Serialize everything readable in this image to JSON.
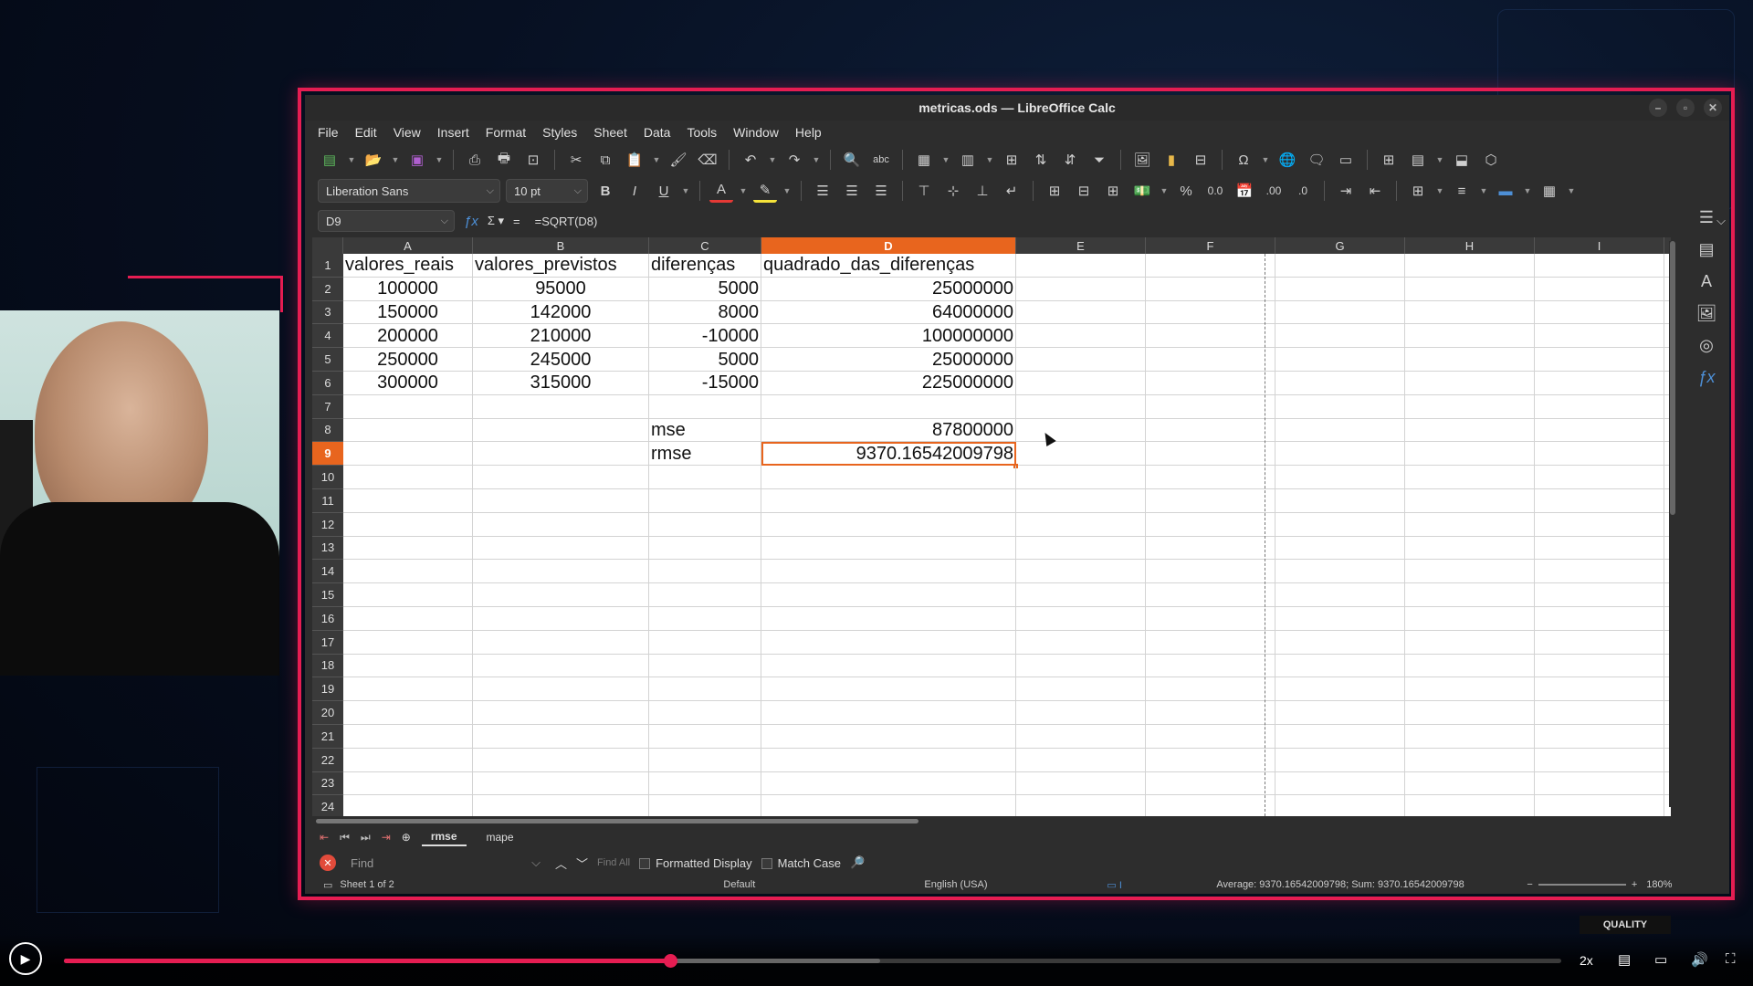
{
  "window": {
    "title": "metricas.ods — LibreOffice Calc"
  },
  "menu": [
    "File",
    "Edit",
    "View",
    "Insert",
    "Format",
    "Styles",
    "Sheet",
    "Data",
    "Tools",
    "Window",
    "Help"
  ],
  "format": {
    "font": "Liberation Sans",
    "size": "10 pt"
  },
  "formula": {
    "cell_ref": "D9",
    "content": "=SQRT(D8)"
  },
  "columns": [
    "A",
    "B",
    "C",
    "D",
    "E",
    "F",
    "G",
    "H",
    "I"
  ],
  "selected_column": "D",
  "rows": [
    "1",
    "2",
    "3",
    "4",
    "5",
    "6",
    "7",
    "8",
    "9",
    "10",
    "11",
    "12",
    "13",
    "14",
    "15",
    "16",
    "17",
    "18",
    "19",
    "20",
    "21",
    "22",
    "23",
    "24"
  ],
  "selected_row": "9",
  "cells": [
    [
      "valores_reais",
      "valores_previstos",
      "diferenças",
      "quadrado_das_diferenças"
    ],
    [
      "100000",
      "95000",
      "5000",
      "25000000"
    ],
    [
      "150000",
      "142000",
      "8000",
      "64000000"
    ],
    [
      "200000",
      "210000",
      "-10000",
      "100000000"
    ],
    [
      "250000",
      "245000",
      "5000",
      "25000000"
    ],
    [
      "300000",
      "315000",
      "-15000",
      "225000000"
    ],
    [
      "",
      "",
      "",
      ""
    ],
    [
      "",
      "",
      "mse",
      "87800000"
    ],
    [
      "",
      "",
      "rmse",
      "9370.16542009798"
    ]
  ],
  "sheet_tabs": [
    {
      "label": "rmse",
      "active": true
    },
    {
      "label": "mape",
      "active": false
    }
  ],
  "find": {
    "placeholder": "Find",
    "find_all": "Find All",
    "formatted_display": "Formatted Display",
    "match_case": "Match Case"
  },
  "status": {
    "sheet": "Sheet 1 of 2",
    "style": "Default",
    "language": "English (USA)",
    "summary": "Average: 9370.16542009798; Sum: 9370.16542009798",
    "zoom": "180%"
  },
  "player": {
    "speed": "2x",
    "quality_label": "QUALITY",
    "progress": 0.405,
    "buffered": 0.545
  },
  "colors": {
    "accent": "#e51d52",
    "selection": "#e8651e"
  }
}
